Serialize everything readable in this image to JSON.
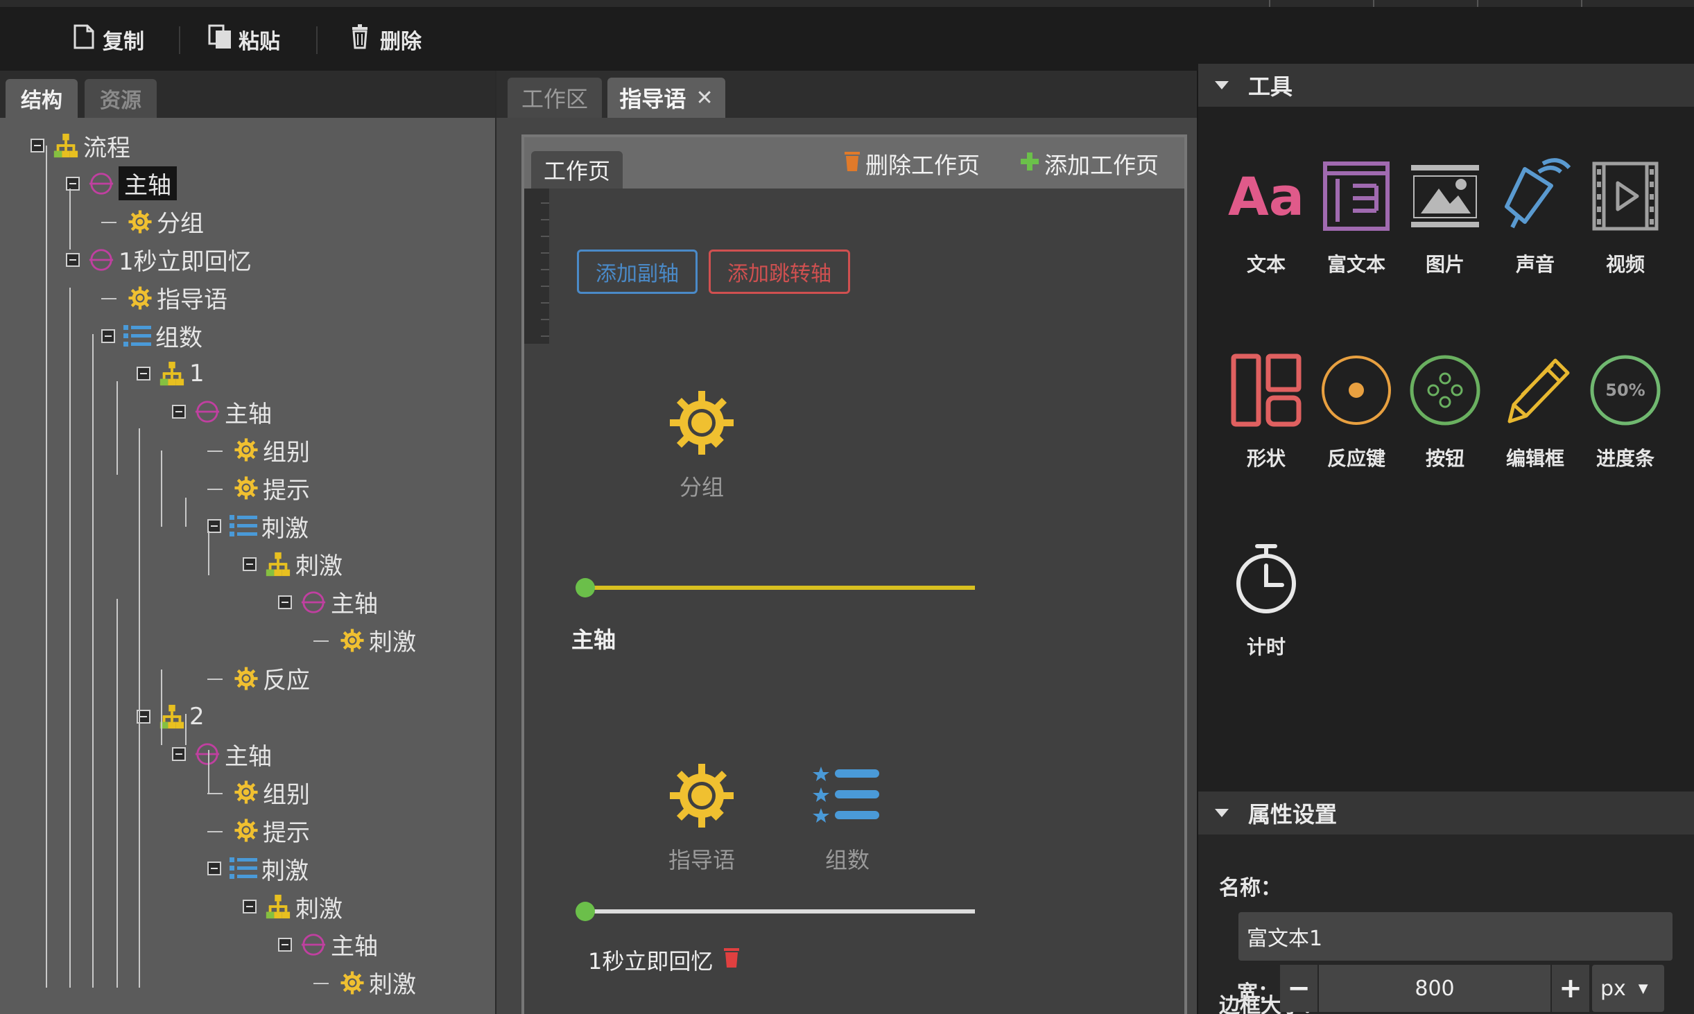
{
  "toolbar": {
    "copy_label": "复制",
    "paste_label": "粘贴",
    "delete_label": "删除"
  },
  "left_panel": {
    "tabs": [
      {
        "label": "结构",
        "active": true
      },
      {
        "label": "资源",
        "active": false
      }
    ],
    "tree": [
      {
        "label": "流程",
        "icon": "hierarchy-icon"
      },
      {
        "label": "主轴",
        "icon": "axis-icon",
        "selected": true
      },
      {
        "label": "分组",
        "icon": "gear-icon"
      },
      {
        "label": "1秒立即回忆",
        "icon": "axis-icon"
      },
      {
        "label": "指导语",
        "icon": "gear-icon"
      },
      {
        "label": "组数",
        "icon": "list-icon"
      },
      {
        "label": "1",
        "icon": "hierarchy-icon"
      },
      {
        "label": "主轴",
        "icon": "axis-icon"
      },
      {
        "label": "组别",
        "icon": "gear-icon"
      },
      {
        "label": "提示",
        "icon": "gear-icon"
      },
      {
        "label": "刺激",
        "icon": "list-icon"
      },
      {
        "label": "刺激",
        "icon": "hierarchy-icon"
      },
      {
        "label": "主轴",
        "icon": "axis-icon"
      },
      {
        "label": "刺激",
        "icon": "gear-icon"
      },
      {
        "label": "反应",
        "icon": "gear-icon"
      },
      {
        "label": "2",
        "icon": "hierarchy-icon"
      },
      {
        "label": "主轴",
        "icon": "axis-icon"
      },
      {
        "label": "组别",
        "icon": "gear-icon"
      },
      {
        "label": "提示",
        "icon": "gear-icon"
      },
      {
        "label": "刺激",
        "icon": "list-icon"
      },
      {
        "label": "刺激",
        "icon": "hierarchy-icon"
      },
      {
        "label": "主轴",
        "icon": "axis-icon"
      },
      {
        "label": "刺激",
        "icon": "gear-icon"
      }
    ]
  },
  "editor": {
    "tabs": [
      {
        "label": "工作区",
        "active": false
      },
      {
        "label": "指导语",
        "active": true,
        "close": "✕"
      }
    ],
    "workpage_tab": "工作页",
    "delete_page": "删除工作页",
    "add_page": "添加工作页",
    "add_sub_axis": "添加副轴",
    "add_jump_axis": "添加跳转轴",
    "group_label": "分组",
    "main_axis_label": "主轴",
    "instruction_label": "指导语",
    "count_label": "组数",
    "recall_axis_label": "1秒立即回忆"
  },
  "tools_panel": {
    "title": "工具",
    "items": [
      {
        "label": "文本",
        "icon": "text-icon",
        "color": "#e05a8a"
      },
      {
        "label": "富文本",
        "icon": "rich-text-icon",
        "color": "#a06ab0"
      },
      {
        "label": "图片",
        "icon": "image-icon",
        "color": "#b8b8b8"
      },
      {
        "label": "声音",
        "icon": "sound-icon",
        "color": "#5a9ad0"
      },
      {
        "label": "视频",
        "icon": "video-icon",
        "color": "#a0a0a0"
      },
      {
        "label": "形状",
        "icon": "shape-icon",
        "color": "#e06060"
      },
      {
        "label": "反应键",
        "icon": "response-key-icon",
        "color": "#e8a040"
      },
      {
        "label": "按钮",
        "icon": "button-icon",
        "color": "#6ab060"
      },
      {
        "label": "编辑框",
        "icon": "edit-box-icon",
        "color": "#e8b830"
      },
      {
        "label": "进度条",
        "icon": "progress-icon",
        "color": "#70b870",
        "text": "50%"
      },
      {
        "label": "计时",
        "icon": "timer-icon",
        "color": "#e8e8e8"
      }
    ]
  },
  "properties_panel": {
    "title": "属性设置",
    "name_label": "名称：",
    "name_value": "富文本1",
    "border_size_label": "边框大小：",
    "width_label": "宽：",
    "width_value": "800",
    "decrement": "−",
    "increment": "+",
    "unit": "px"
  },
  "colors": {
    "gear": "#f0c030",
    "axis": "#c040a0",
    "list": "#4a9ad8",
    "timeline_main": "#d8c020",
    "timeline_recall": "#dddddd",
    "timeline_dot": "#6bbf4a",
    "sub_axis_border": "#4a8ac8",
    "jump_axis_border": "#d05050"
  }
}
